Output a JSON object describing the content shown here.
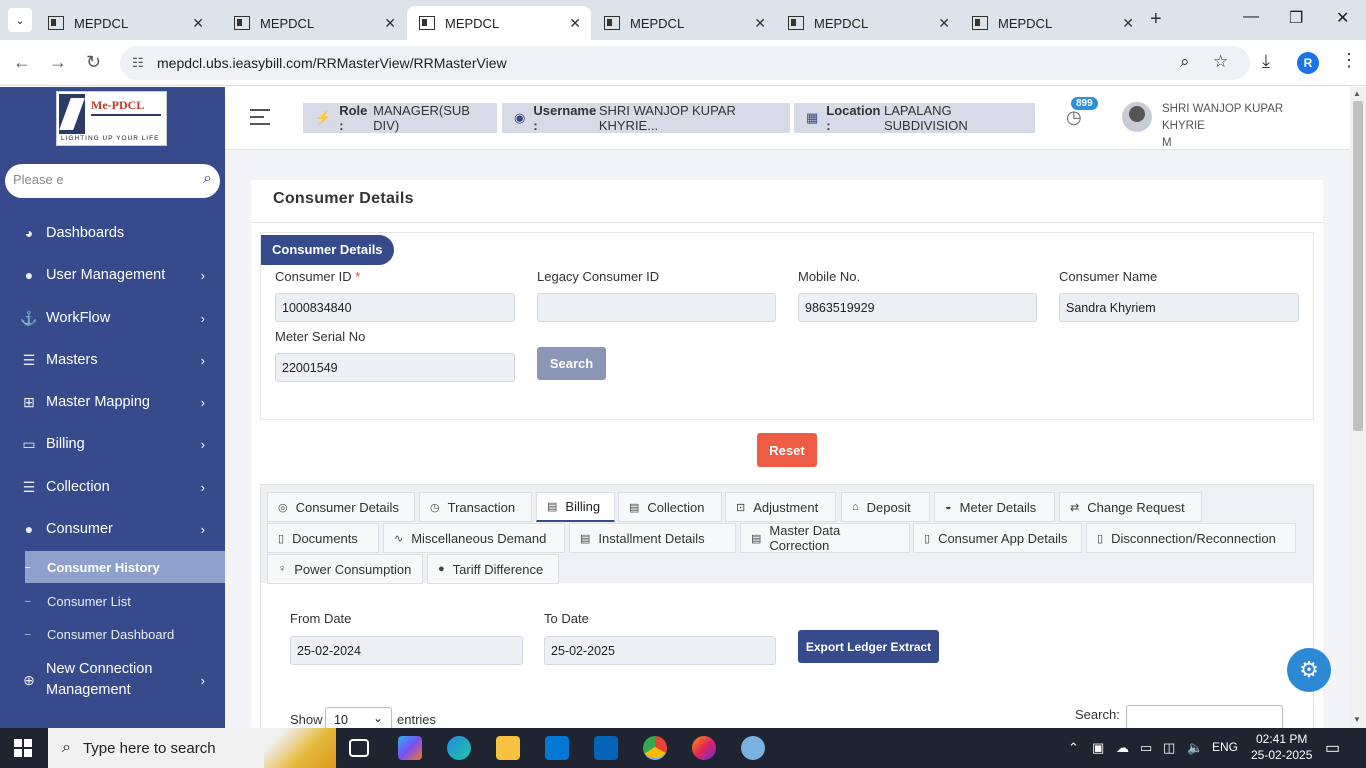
{
  "browser": {
    "tabs": [
      {
        "title": "MEPDCL",
        "active": false
      },
      {
        "title": "MEPDCL",
        "active": false
      },
      {
        "title": "MEPDCL",
        "active": true
      },
      {
        "title": "MEPDCL",
        "active": false
      },
      {
        "title": "MEPDCL",
        "active": false
      },
      {
        "title": "MEPDCL",
        "active": false
      }
    ],
    "url": "mepdcl.ubs.ieasybill.com/RRMasterView/RRMasterView",
    "profile_initial": "R"
  },
  "logo": {
    "brand": "Me-PDCL",
    "tagline": "LIGHTING UP YOUR LIFE"
  },
  "sidebar": {
    "search_placeholder": "Please e",
    "items": [
      {
        "label": "Dashboards",
        "icon": "dashboard-icon",
        "has_arrow": false
      },
      {
        "label": "User Management",
        "icon": "user-icon",
        "has_arrow": true
      },
      {
        "label": "WorkFlow",
        "icon": "anchor-icon",
        "has_arrow": true
      },
      {
        "label": "Masters",
        "icon": "list-icon",
        "has_arrow": true
      },
      {
        "label": "Master Mapping",
        "icon": "sitemap-icon",
        "has_arrow": true
      },
      {
        "label": "Billing",
        "icon": "desktop-icon",
        "has_arrow": true
      },
      {
        "label": "Collection",
        "icon": "list-icon",
        "has_arrow": true
      },
      {
        "label": "Consumer",
        "icon": "user-icon",
        "has_arrow": true
      }
    ],
    "sub_items": [
      {
        "label": "Consumer History",
        "active": true
      },
      {
        "label": "Consumer List",
        "active": false
      },
      {
        "label": "Consumer Dashboard",
        "active": false
      }
    ],
    "new_connection": {
      "label_line1": "New Connection",
      "label_line2": "Management"
    }
  },
  "header": {
    "role_label": "Role :",
    "role_value": "MANAGER(SUB DIV)",
    "username_label": "Username :",
    "username_value": "SHRI WANJOP KUPAR KHYRIE...",
    "location_label": "Location :",
    "location_value": "LAPALANG SUBDIVISION",
    "notification_count": "899",
    "user_name_line1": "SHRI WANJOP KUPAR KHYRIE",
    "user_name_line2": "M"
  },
  "page": {
    "title": "Consumer Details",
    "section_legend": "Consumer Details",
    "fields": {
      "consumer_id_label": "Consumer ID",
      "consumer_id_value": "1000834840",
      "legacy_id_label": "Legacy Consumer ID",
      "legacy_id_value": "",
      "mobile_label": "Mobile No.",
      "mobile_value": "9863519929",
      "name_label": "Consumer Name",
      "name_value": "Sandra Khyriem",
      "meter_label": "Meter Serial No",
      "meter_value": "22001549"
    },
    "search_button": "Search",
    "reset_button": "Reset",
    "tabs": [
      {
        "label": "Consumer Details",
        "icon": "◎",
        "active": false
      },
      {
        "label": "Transaction",
        "icon": "◷",
        "active": false
      },
      {
        "label": "Billing",
        "icon": "▤",
        "active": true
      },
      {
        "label": "Collection",
        "icon": "▤",
        "active": false
      },
      {
        "label": "Adjustment",
        "icon": "⊡",
        "active": false
      },
      {
        "label": "Deposit",
        "icon": "⌂",
        "active": false
      },
      {
        "label": "Meter Details",
        "icon": "◒",
        "active": false
      },
      {
        "label": "Change Request",
        "icon": "⇄",
        "active": false
      },
      {
        "label": "Documents",
        "icon": "▯",
        "active": false
      },
      {
        "label": "Miscellaneous Demand",
        "icon": "∿",
        "active": false
      },
      {
        "label": "Installment Details",
        "icon": "▤",
        "active": false
      },
      {
        "label": "Master Data Correction",
        "icon": "▤",
        "active": false
      },
      {
        "label": "Consumer App Details",
        "icon": "▯",
        "active": false
      },
      {
        "label": "Disconnection/Reconnection",
        "icon": "▯",
        "active": false
      },
      {
        "label": "Power Consumption",
        "icon": "♀",
        "active": false
      },
      {
        "label": "Tariff Difference",
        "icon": "●",
        "active": false
      }
    ],
    "from_date_label": "From Date",
    "from_date_value": "25-02-2024",
    "to_date_label": "To Date",
    "to_date_value": "25-02-2025",
    "export_button": "Export Ledger Extract",
    "show_label": "Show",
    "entries_value": "10",
    "entries_label": "entries",
    "search_label": "Search:"
  },
  "taskbar": {
    "search_placeholder": "Type here to search",
    "language": "ENG",
    "time": "02:41 PM",
    "date": "25-02-2025"
  }
}
